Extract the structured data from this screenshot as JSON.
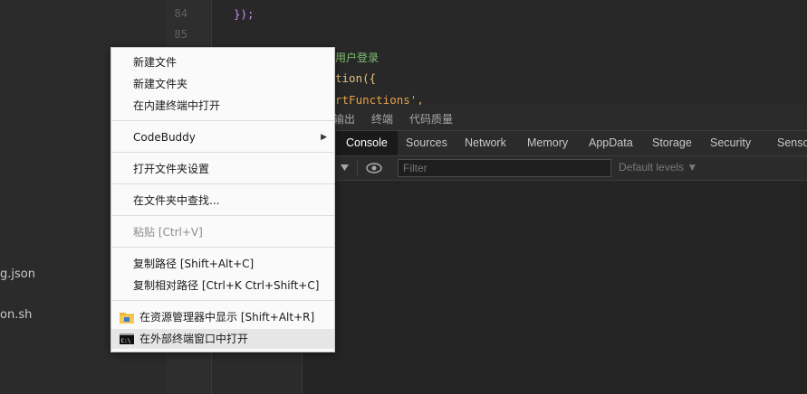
{
  "sidebar": {
    "files": [
      "g.json",
      "on.sh"
    ]
  },
  "gutter": {
    "line_numbers": [
      "84",
      "85"
    ]
  },
  "editor": {
    "lines": [
      {
        "text": "});",
        "color": "#c792ea"
      },
      {
        "text": "用户登录",
        "color": "#7ec16e"
      },
      {
        "text": "tion({",
        "color": "#e5c07b"
      },
      {
        "text": "rtFunctions',",
        "color": "#e5a24a"
      }
    ]
  },
  "panel_tabs": [
    "输出",
    "终端",
    "代码质量"
  ],
  "devtools": {
    "tabs": [
      "Console",
      "Sources",
      "Network",
      "Memory",
      "AppData",
      "Storage",
      "Security",
      "Senso"
    ],
    "active_tab": "Console",
    "toolbar": {
      "dropdown_icon": "triangle-down-icon",
      "eye_icon": "eye-icon",
      "filter_placeholder": "Filter",
      "levels_label": "Default levels ▼"
    }
  },
  "context_menu": {
    "items": [
      {
        "label": "新建文件"
      },
      {
        "label": "新建文件夹"
      },
      {
        "label": "在内建终端中打开"
      },
      {
        "label": "CodeBuddy",
        "submenu": "▶"
      },
      {
        "label": "打开文件夹设置"
      },
      {
        "label": "在文件夹中查找..."
      },
      {
        "label": "粘贴  [Ctrl+V]",
        "disabled": true
      },
      {
        "label": "复制路径  [Shift+Alt+C]"
      },
      {
        "label": "复制相对路径  [Ctrl+K Ctrl+Shift+C]"
      },
      {
        "label": "在资源管理器中显示  [Shift+Alt+R]",
        "icon": "folder-icon"
      },
      {
        "label": "在外部终端窗口中打开",
        "icon": "terminal-icon",
        "highlighted": true
      }
    ]
  },
  "colors": {
    "menu_bg": "#fafafa",
    "menu_hover": "#e6e6e6",
    "active_tab_bg": "#1a1a1a",
    "folder_yellow": "#e8b53a"
  }
}
